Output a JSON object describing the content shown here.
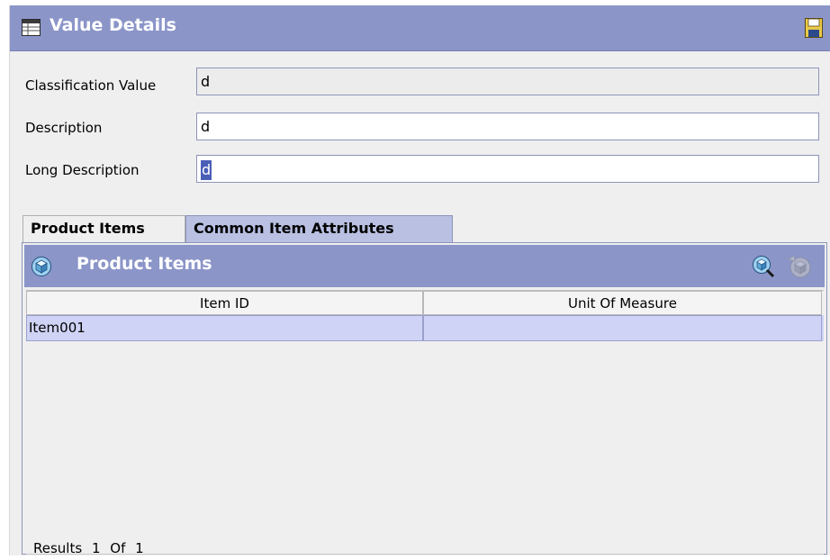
{
  "window": {
    "title": "Value Details",
    "icons": {
      "title": "table-icon",
      "save": "save-icon"
    }
  },
  "fields": {
    "classification_value": {
      "label": "Classification Value",
      "value": "d"
    },
    "description": {
      "label": "Description",
      "value": "d"
    },
    "long_description": {
      "label": "Long Description",
      "value": "d"
    }
  },
  "tabs": [
    {
      "label": "Product Items",
      "active": true
    },
    {
      "label": "Common Item Attributes",
      "active": false
    }
  ],
  "panel": {
    "title": "Product Items",
    "icons": {
      "panel": "cube-icon",
      "find": "find-item-icon",
      "disabled": "item-disabled-icon"
    }
  },
  "table": {
    "columns": [
      "Item ID",
      "Unit Of Measure"
    ],
    "rows": [
      [
        "Item001",
        ""
      ]
    ]
  },
  "results": {
    "label": "Results",
    "current": "1",
    "of_label": "Of",
    "total": "1"
  },
  "colors": {
    "header_bg": "#8b95c8",
    "tab_inactive_bg": "#b9c0e2",
    "selected_row_bg": "#cfd3f5",
    "window_bg": "#efefef"
  }
}
